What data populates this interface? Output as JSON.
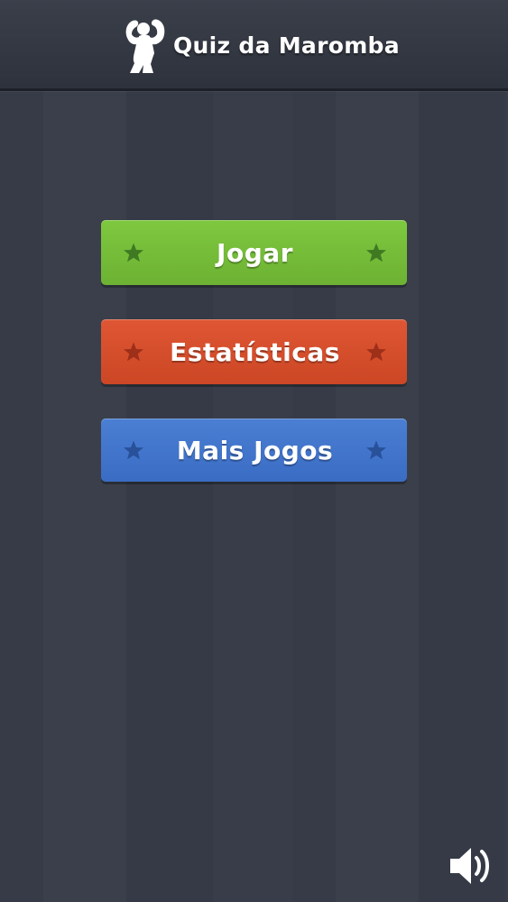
{
  "header": {
    "title": "Quiz da Maromba",
    "logo_icon": "flexing-bodybuilder-icon"
  },
  "menu": {
    "buttons": [
      {
        "label": "Jogar",
        "color": "#76bd39",
        "star_color": "#3f7a23",
        "icon": "star-icon"
      },
      {
        "label": "Estatísticas",
        "color": "#d54f2c",
        "star_color": "#9e2f18",
        "icon": "star-icon"
      },
      {
        "label": "Mais Jogos",
        "color": "#4276cc",
        "star_color": "#28519a",
        "icon": "star-icon"
      }
    ]
  },
  "controls": {
    "sound_icon": "speaker-volume-icon"
  },
  "colors": {
    "background": "#363b47",
    "header": "#30343e"
  }
}
